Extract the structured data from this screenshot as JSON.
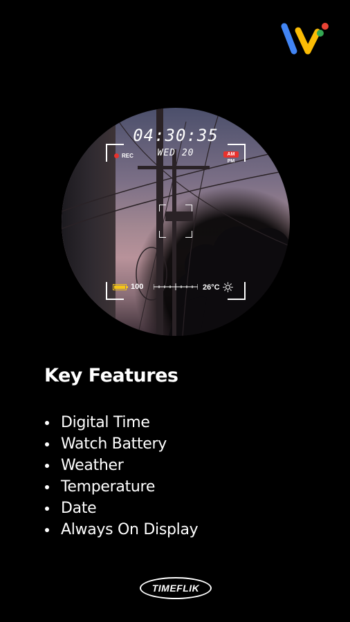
{
  "watch": {
    "time": "04:30:35",
    "date": "WED 20",
    "rec_label": "REC",
    "am_label": "AM",
    "pm_label": "PM",
    "battery": "100",
    "battery_level": 1.0,
    "temperature": "26°C"
  },
  "features": {
    "title": "Key Features",
    "items": [
      "Digital Time",
      "Watch Battery",
      "Weather",
      "Temperature",
      "Date",
      "Always On Display"
    ]
  },
  "brand": {
    "name": "TIMEFLIK"
  },
  "colors": {
    "background": "#000000",
    "rec_red": "#e8322d",
    "battery_yellow": "#f5c518",
    "wearos_blue": "#4285f4",
    "wearos_yellow": "#fbbc05",
    "wearos_red": "#ea4335",
    "wearos_green": "#34a853"
  },
  "icons": [
    "wearos-logo",
    "rec-dot",
    "battery-icon",
    "sun-icon",
    "focus-icon"
  ]
}
